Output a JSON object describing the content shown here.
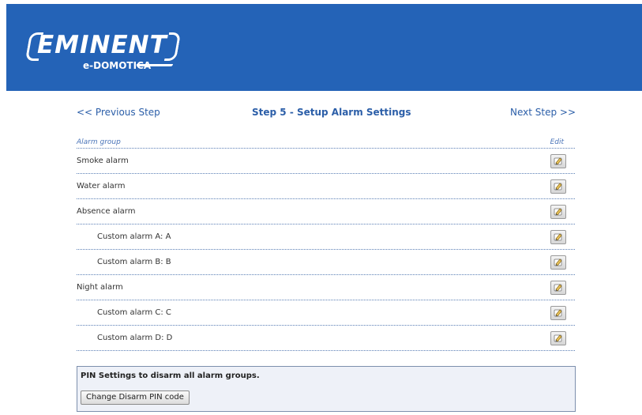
{
  "header": {
    "brand": "EMINENT",
    "sub_brand": "e-DOMOTICA",
    "background_color": "#2463b7"
  },
  "nav": {
    "previous": "<<   Previous Step",
    "title": "Step 5 - Setup Alarm Settings",
    "next": "Next Step   >>"
  },
  "table": {
    "col_group": "Alarm group",
    "col_edit": "Edit",
    "rows": [
      {
        "label": "Smoke alarm",
        "indent": false
      },
      {
        "label": "Water alarm",
        "indent": false
      },
      {
        "label": "Absence alarm",
        "indent": false
      },
      {
        "label": "Custom alarm A: A",
        "indent": true
      },
      {
        "label": "Custom alarm B: B",
        "indent": true
      },
      {
        "label": "Night alarm",
        "indent": false
      },
      {
        "label": "Custom alarm C: C",
        "indent": true
      },
      {
        "label": "Custom alarm D: D",
        "indent": true
      }
    ],
    "edit_icon": "edit-pencil-icon"
  },
  "pin": {
    "title": "PIN Settings to disarm all alarm groups.",
    "button": "Change Disarm PIN code"
  }
}
